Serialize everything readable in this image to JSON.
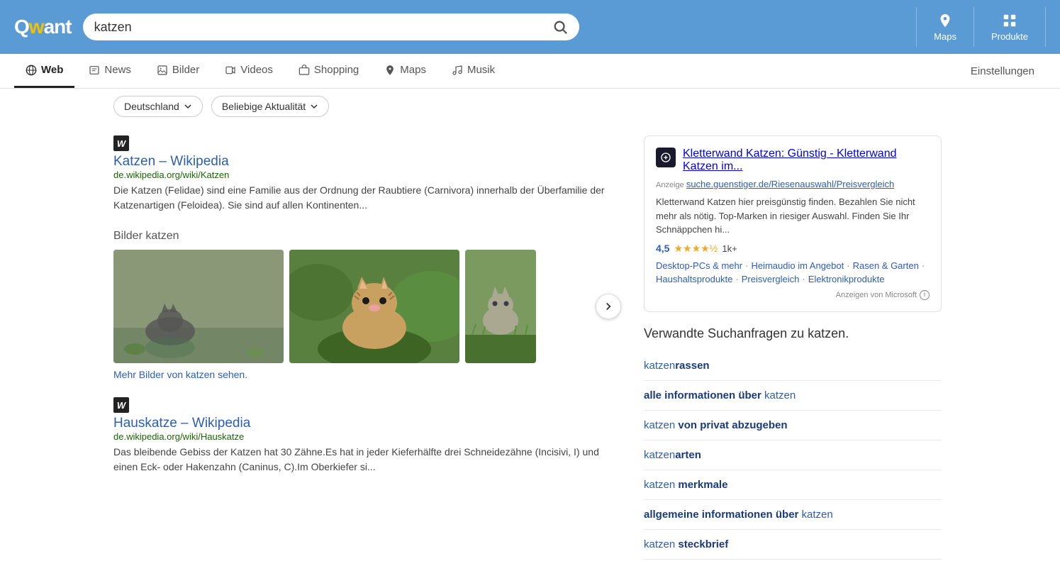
{
  "header": {
    "logo": "Qwant",
    "search_value": "katzen",
    "search_placeholder": "katzen",
    "maps_label": "Maps",
    "produkte_label": "Produkte"
  },
  "nav": {
    "tabs": [
      {
        "id": "web",
        "label": "Web",
        "active": true
      },
      {
        "id": "news",
        "label": "News",
        "active": false
      },
      {
        "id": "bilder",
        "label": "Bilder",
        "active": false
      },
      {
        "id": "videos",
        "label": "Videos",
        "active": false
      },
      {
        "id": "shopping",
        "label": "Shopping",
        "active": false
      },
      {
        "id": "maps",
        "label": "Maps",
        "active": false
      },
      {
        "id": "musik",
        "label": "Musik",
        "active": false
      }
    ],
    "settings_label": "Einstellungen"
  },
  "filters": {
    "region_label": "Deutschland",
    "recency_label": "Beliebige Aktualität"
  },
  "results": {
    "result1": {
      "title": "Katzen – Wikipedia",
      "url": "de.wikipedia.org/wiki/Katzen",
      "description": "Die Katzen (Felidae) sind eine Familie aus der Ordnung der Raubtiere (Carnivora) innerhalb der Überfamilie der Katzenartigen (Feloidea). Sie sind auf allen Kontinenten..."
    },
    "images_heading": "Bilder katzen",
    "images_more": "Mehr Bilder von katzen sehen.",
    "result2": {
      "title": "Hauskatze – Wikipedia",
      "url": "de.wikipedia.org/wiki/Hauskatze",
      "description": "Das bleibende Gebiss der Katzen hat 30 Zähne.Es hat in jeder Kieferhälfte drei Schneidezähne (Incisivi, I) und einen Eck- oder Hakenzahn (Caninus, C).Im Oberkiefer si..."
    }
  },
  "ad": {
    "title": "Kletterwand Katzen: Günstig - Kletterwand Katzen im...",
    "ad_label": "Anzeige",
    "url": "suche.guenstiger.de/Riesenauswahl/Preisvergleich",
    "description": "Kletterwand Katzen hier preisgünstig finden. Bezahlen Sie nicht mehr als nötig. Top-Marken in riesiger Auswahl. Finden Sie Ihr Schnäppchen hi...",
    "rating": "4,5",
    "rating_count": "1k+",
    "links": [
      "Desktop-PCs & mehr",
      "Heimaudio im Angebot",
      "Rasen & Garten",
      "Haushaltsprodukte",
      "Preisvergleich",
      "Elektronikprodukte"
    ],
    "footer": "Anzeigen von Microsoft"
  },
  "related": {
    "heading": "Verwandte Suchanfragen zu katzen.",
    "items": [
      {
        "prefix": "katzen",
        "suffix": "rassen"
      },
      {
        "prefix": "alle informationen über",
        "suffix": "katzen"
      },
      {
        "prefix": "katzen",
        "suffix": "von privat abzugeben"
      },
      {
        "prefix": "katzen",
        "suffix": "arten"
      },
      {
        "prefix": "katzen",
        "suffix": "merkmale"
      },
      {
        "prefix": "allgemeine informationen über",
        "suffix": "katzen"
      },
      {
        "prefix": "katzen",
        "suffix": "steckbrief"
      }
    ]
  }
}
